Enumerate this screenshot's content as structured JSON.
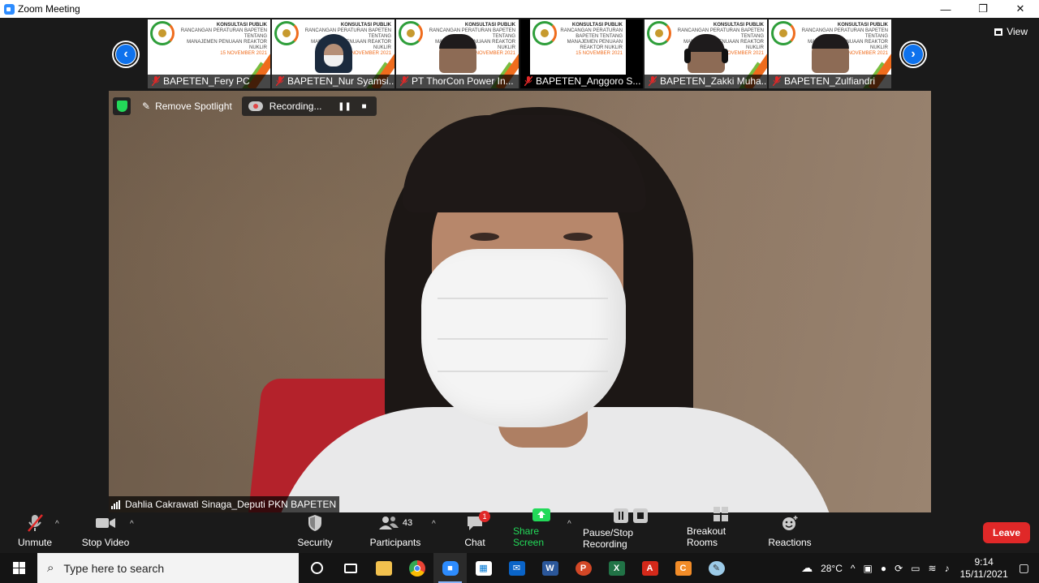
{
  "window": {
    "title": "Zoom Meeting",
    "controls": {
      "minimize": "—",
      "restore": "❐",
      "close": "✕"
    }
  },
  "view_button": {
    "label": "View"
  },
  "thumbnails": [
    {
      "name": "BAPETEN_Fery PC",
      "has_person": false
    },
    {
      "name": "BAPETEN_Nur Syamsi...",
      "has_person": true,
      "style": "hijab"
    },
    {
      "name": "PT ThorCon Power In...",
      "has_person": true,
      "style": "plain"
    },
    {
      "name": "BAPETEN_Anggoro S...",
      "has_person": false
    },
    {
      "name": "BAPETEN_Zakki Muha...",
      "has_person": true,
      "style": "headset"
    },
    {
      "name": "BAPETEN_Zulfiandri",
      "has_person": true,
      "style": "plain"
    }
  ],
  "banner": {
    "title": "KONSULTASI PUBLIK",
    "line1": "RANCANGAN PERATURAN BAPETEN TENTANG",
    "line2": "MANAJEMEN PENUAAN REAKTOR NUKLIR",
    "date": "15 NOVEMBER 2021"
  },
  "overlay": {
    "remove_spotlight": "Remove Spotlight",
    "recording": "Recording..."
  },
  "speaker": {
    "name": "Dahlia Cakrawati Sinaga_Deputi PKN BAPETEN"
  },
  "toolbar": {
    "unmute": "Unmute",
    "stop_video": "Stop Video",
    "security": "Security",
    "participants": "Participants",
    "participants_count": "43",
    "chat": "Chat",
    "chat_badge": "1",
    "share_screen": "Share Screen",
    "pause_stop_recording": "Pause/Stop Recording",
    "breakout_rooms": "Breakout Rooms",
    "reactions": "Reactions",
    "leave": "Leave"
  },
  "taskbar": {
    "search_placeholder": "Type here to search",
    "weather": "28°C",
    "time": "9:14",
    "date": "15/11/2021"
  },
  "colors": {
    "zoom_blue": "#0e72ed",
    "share_green": "#23d959",
    "leave_red": "#e02828"
  }
}
